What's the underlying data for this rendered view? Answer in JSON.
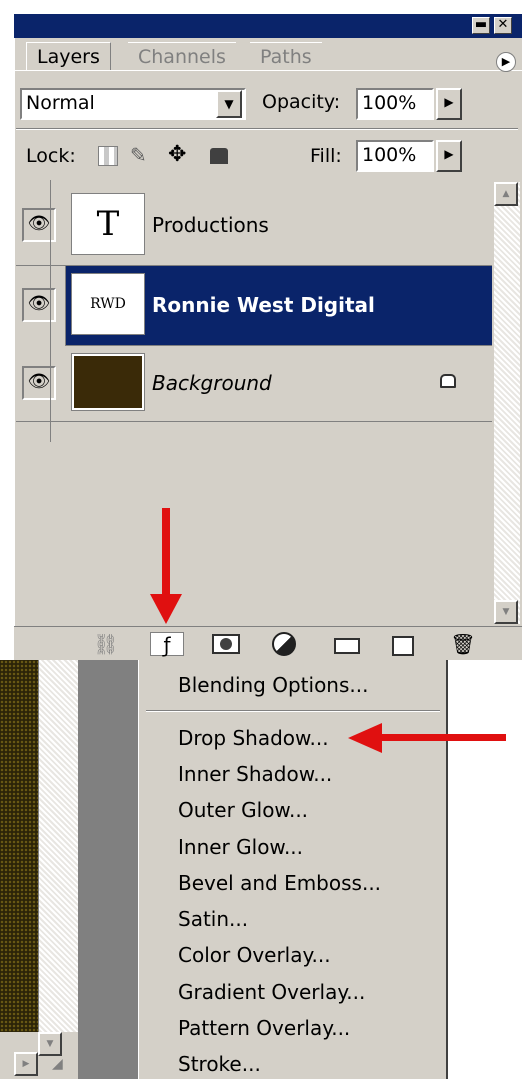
{
  "tabs": [
    {
      "label": "Layers",
      "active": true
    },
    {
      "label": "Channels",
      "active": false
    },
    {
      "label": "Paths",
      "active": false
    }
  ],
  "blend": {
    "mode": "Normal",
    "opacity_label": "Opacity:",
    "opacity_value": "100%"
  },
  "lock": {
    "label": "Lock:",
    "fill_label": "Fill:",
    "fill_value": "100%"
  },
  "layers": [
    {
      "name": "Productions",
      "thumb": "T",
      "selected": false
    },
    {
      "name": "Ronnie West Digital",
      "thumb": "RWD",
      "selected": true
    },
    {
      "name": "Background",
      "thumb": "",
      "selected": false,
      "locked": true
    }
  ],
  "menu": {
    "top_item": "Blending Options...",
    "items": [
      "Drop Shadow...",
      "Inner Shadow...",
      "Outer Glow...",
      "Inner Glow...",
      "Bevel and Emboss...",
      "Satin...",
      "Color Overlay...",
      "Gradient Overlay...",
      "Pattern Overlay...",
      "Stroke..."
    ]
  },
  "colors": {
    "selection": "#0a246a",
    "panel": "#d4d0c8",
    "annotation": "#e01010",
    "background_layer": "#3a2a08"
  }
}
